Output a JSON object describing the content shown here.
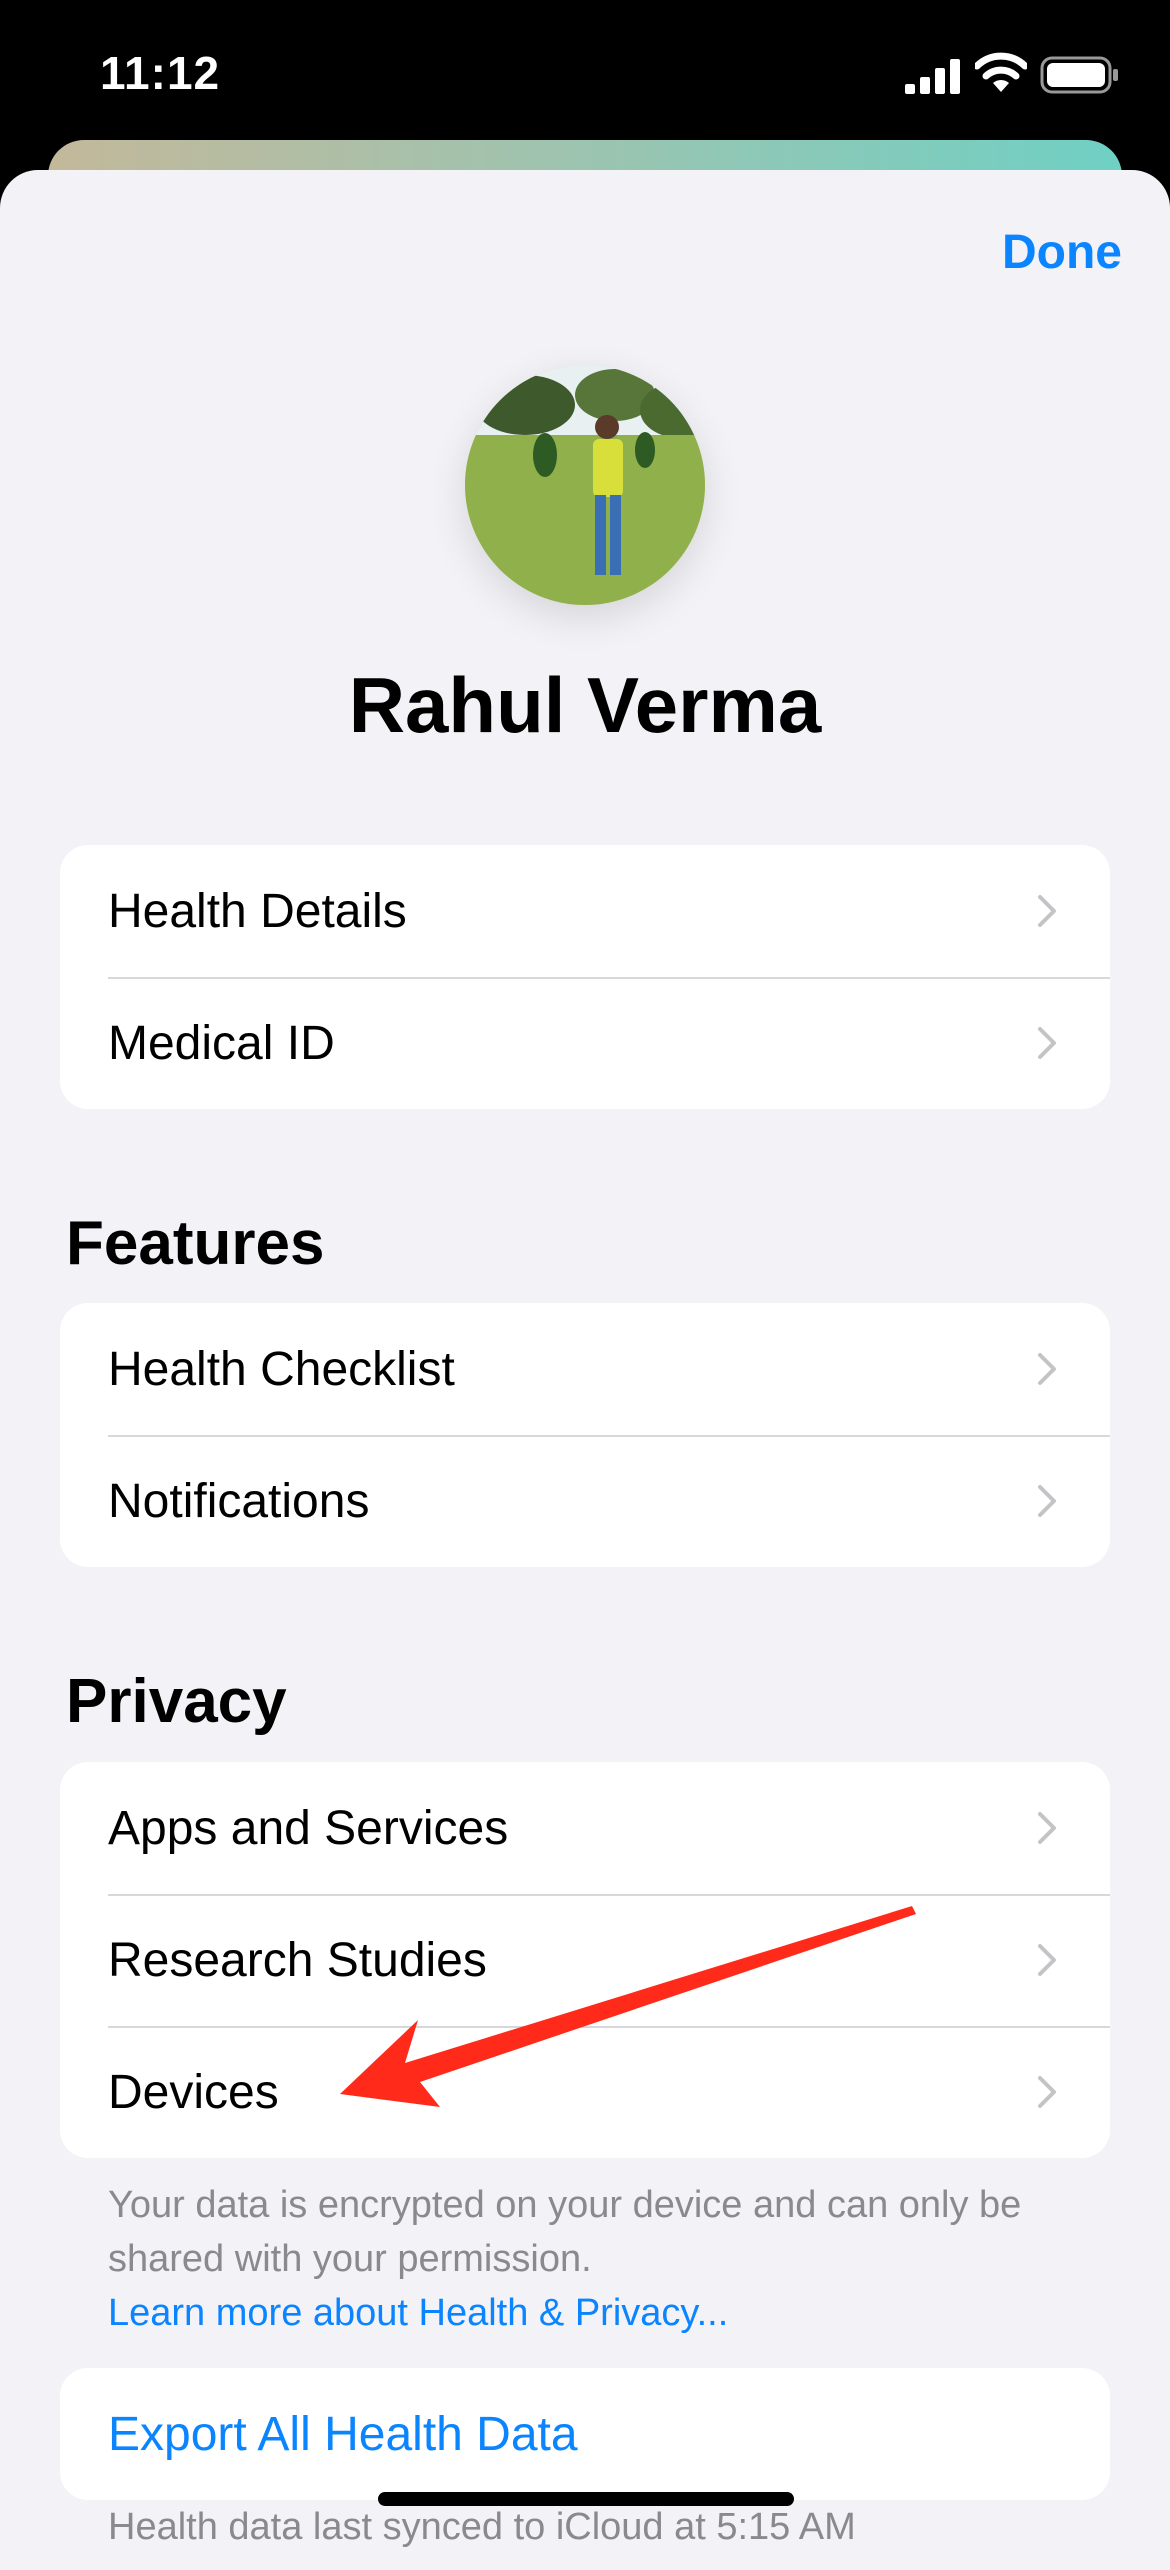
{
  "status_bar": {
    "time": "11:12"
  },
  "header": {
    "done_label": "Done"
  },
  "profile": {
    "name": "Rahul Verma"
  },
  "account_group": {
    "items": [
      {
        "label": "Health Details"
      },
      {
        "label": "Medical ID"
      }
    ]
  },
  "features": {
    "title": "Features",
    "items": [
      {
        "label": "Health Checklist"
      },
      {
        "label": "Notifications"
      }
    ]
  },
  "privacy": {
    "title": "Privacy",
    "items": [
      {
        "label": "Apps and Services"
      },
      {
        "label": "Research Studies"
      },
      {
        "label": "Devices"
      }
    ],
    "footnote": "Your data is encrypted on your device and can only be shared with your permission.",
    "learn_more": "Learn more about Health & Privacy..."
  },
  "export": {
    "label": "Export All Health Data",
    "sub_note": "Health data last synced to iCloud at 5:15 AM"
  },
  "colors": {
    "accent": "#0a84ff",
    "annotation_arrow": "#ff2a1a",
    "background": "#f2f2f7"
  }
}
